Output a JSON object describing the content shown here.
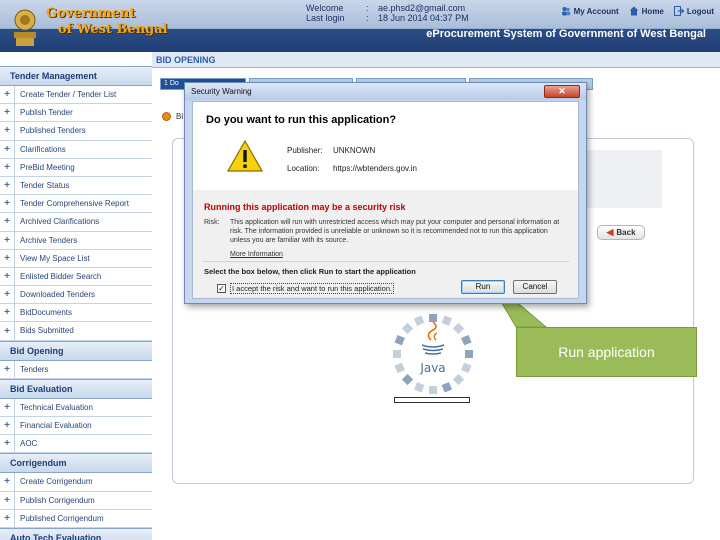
{
  "header": {
    "gov_line1": "Government",
    "gov_line2": "of West Bengal",
    "welcome_label": "Welcome",
    "welcome_value": "ae.phsd2@gmail.com",
    "last_login_label": "Last login",
    "last_login_value": "18 Jun 2014 04:37 PM",
    "separator": ":",
    "my_account": "My Account",
    "home": "Home",
    "logout": "Logout",
    "portal_title": "eProcurement System of Government of West Bengal"
  },
  "sidebar": {
    "sections": [
      {
        "title": "Tender Management",
        "items": [
          "Create Tender / Tender List",
          "Publish Tender",
          "Published Tenders",
          "Clarifications",
          "PreBid Meeting",
          "Tender Status",
          "Tender Comprehensive Report",
          "Archived Clarifications",
          "Archive Tenders",
          "View My Space List",
          "Enlisted Bidder Search",
          "Downloaded Tenders",
          "BidDocuments",
          "Bids Submitted"
        ]
      },
      {
        "title": "Bid Opening",
        "items": [
          "Tenders"
        ]
      },
      {
        "title": "Bid Evaluation",
        "items": [
          "Technical Evaluation",
          "Financial Evaluation",
          "AOC"
        ]
      },
      {
        "title": "Corrigendum",
        "items": [
          "Create Corrigendum",
          "Publish Corrigendum",
          "Published Corrigendum"
        ]
      },
      {
        "title": "Auto Tech Evaluation",
        "items": []
      }
    ]
  },
  "main": {
    "page_title": "BID OPENING",
    "step_tab_first": "1  Do",
    "bullet_text": "Bi",
    "back_label": "Back"
  },
  "dialog": {
    "title": "Security Warning",
    "close_glyph": "✕",
    "question": "Do you want to run this application?",
    "publisher_label": "Publisher:",
    "publisher_value": "UNKNOWN",
    "location_label": "Location:",
    "location_value": "https://wbtenders.gov.in",
    "risk_heading": "Running this application may be a security risk",
    "risk_label": "Risk:",
    "risk_text": "This application will run with unrestricted access which may put your computer and personal information at risk. The information provided is unreliable or unknown so it is recommended not to run this application unless you are familiar with its source.",
    "more_info": "More Information",
    "instruction": "Select the box below, then click Run to start the application",
    "accept_label": "I accept the risk and want to run this application.",
    "checkbox_mark": "✓",
    "run_label": "Run",
    "cancel_label": "Cancel"
  },
  "java": {
    "label": "Java"
  },
  "callout": {
    "text": "Run application",
    "color": "#9bbb59"
  },
  "colors": {
    "header_dark": "#1f3d73",
    "gov_title": "#f2a515",
    "risk_red": "#c00000",
    "link_blue": "#2a5ba8"
  }
}
